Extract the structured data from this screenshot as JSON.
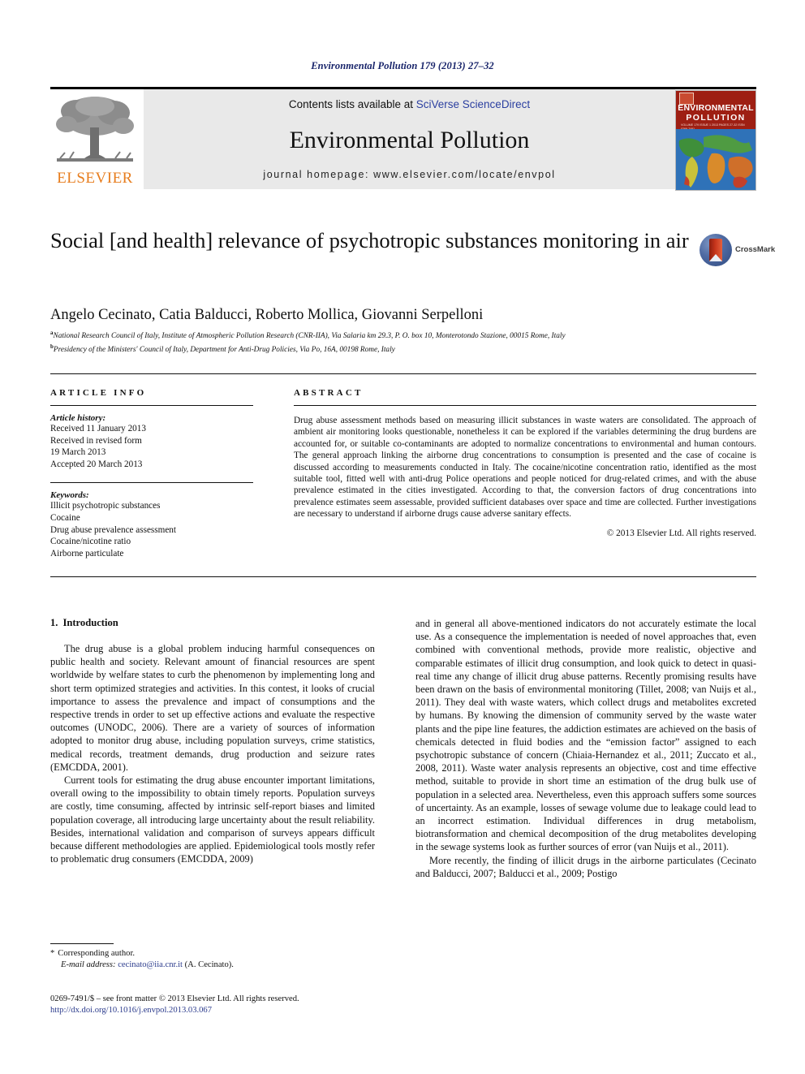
{
  "running_head": "Environmental Pollution 179 (2013) 27–32",
  "masthead": {
    "publisher_logo_label": "ELSEVIER",
    "contents_prefix": "Contents lists available at ",
    "contents_link": "SciVerse ScienceDirect",
    "journal_title": "Environmental Pollution",
    "homepage_line": "journal homepage: www.elsevier.com/locate/envpol",
    "cover": {
      "line1": "ENVIRONMENTAL",
      "line2": "POLLUTION",
      "meta": "VOLUME 179   ISSUE 1   2013   PAGES 27-32   ISSN 0269-7491"
    }
  },
  "article": {
    "title": "Social [and health] relevance of psychotropic substances monitoring in air",
    "crossmark_label": "CrossMark",
    "authors": "Angelo Cecinato, Catia Balducci, Roberto Mollica, Giovanni Serpelloni",
    "affiliation_a": "National Research Council of Italy, Institute of Atmospheric Pollution Research (CNR-IIA), Via Salaria km 29.3, P. O. box 10, Monterotondo Stazione, 00015 Rome, Italy",
    "affiliation_b": "Presidency of the Ministers' Council of Italy, Department for Anti-Drug Policies, Via Po, 16A, 00198 Rome, Italy"
  },
  "article_info": {
    "heading": "ARTICLE INFO",
    "history_label": "Article history:",
    "history": [
      "Received 11 January 2013",
      "Received in revised form",
      "19 March 2013",
      "Accepted 20 March 2013"
    ],
    "keywords_label": "Keywords:",
    "keywords": [
      "Illicit psychotropic substances",
      "Cocaine",
      "Drug abuse prevalence assessment",
      "Cocaine/nicotine ratio",
      "Airborne particulate"
    ]
  },
  "abstract": {
    "heading": "ABSTRACT",
    "text": "Drug abuse assessment methods based on measuring illicit substances in waste waters are consolidated. The approach of ambient air monitoring looks questionable, nonetheless it can be explored if the variables determining the drug burdens are accounted for, or suitable co-contaminants are adopted to normalize concentrations to environmental and human contours. The general approach linking the airborne drug concentrations to consumption is presented and the case of cocaine is discussed according to measurements conducted in Italy. The cocaine/nicotine concentration ratio, identified as the most suitable tool, fitted well with anti-drug Police operations and people noticed for drug-related crimes, and with the abuse prevalence estimated in the cities investigated. According to that, the conversion factors of drug concentrations into prevalence estimates seem assessable, provided sufficient databases over space and time are collected. Further investigations are necessary to understand if airborne drugs cause adverse sanitary effects.",
    "copyright": "© 2013 Elsevier Ltd. All rights reserved."
  },
  "section": {
    "number": "1.",
    "heading": "Introduction"
  },
  "body": {
    "left": [
      "The drug abuse is a global problem inducing harmful consequences on public health and society. Relevant amount of financial resources are spent worldwide by welfare states to curb the phenomenon by implementing long and short term optimized strategies and activities. In this contest, it looks of crucial importance to assess the prevalence and impact of consumptions and the respective trends in order to set up effective actions and evaluate the respective outcomes (UNODC, 2006). There are a variety of sources of information adopted to monitor drug abuse, including population surveys, crime statistics, medical records, treatment demands, drug production and seizure rates (EMCDDA, 2001).",
      "Current tools for estimating the drug abuse encounter important limitations, overall owing to the impossibility to obtain timely reports. Population surveys are costly, time consuming, affected by intrinsic self-report biases and limited population coverage, all introducing large uncertainty about the result reliability. Besides, international validation and comparison of surveys appears difficult because different methodologies are applied. Epidemiological tools mostly refer to problematic drug consumers (EMCDDA, 2009)"
    ],
    "right": [
      "and in general all above-mentioned indicators do not accurately estimate the local use. As a consequence the implementation is needed of novel approaches that, even combined with conventional methods, provide more realistic, objective and comparable estimates of illicit drug consumption, and look quick to detect in quasi-real time any change of illicit drug abuse patterns. Recently promising results have been drawn on the basis of environmental monitoring (Tillet, 2008; van Nuijs et al., 2011). They deal with waste waters, which collect drugs and metabolites excreted by humans. By knowing the dimension of community served by the waste water plants and the pipe line features, the addiction estimates are achieved on the basis of chemicals detected in fluid bodies and the “emission factor” assigned to each psychotropic substance of concern (Chiaia-Hernandez et al., 2011; Zuccato et al., 2008, 2011). Waste water analysis represents an objective, cost and time effective method, suitable to provide in short time an estimation of the drug bulk use of population in a selected area. Nevertheless, even this approach suffers some sources of uncertainty. As an example, losses of sewage volume due to leakage could lead to an incorrect estimation. Individual differences in drug metabolism, biotransformation and chemical decomposition of the drug metabolites developing in the sewage systems look as further sources of error (van Nuijs et al., 2011).",
      "More recently, the finding of illicit drugs in the airborne particulates (Cecinato and Balducci, 2007; Balducci et al., 2009; Postigo"
    ]
  },
  "footnote": {
    "corresponding": "Corresponding author.",
    "email_label": "E-mail address:",
    "email": "cecinato@iia.cnr.it",
    "email_suffix": "(A. Cecinato)."
  },
  "copyright_block": {
    "issn_line": "0269-7491/$ – see front matter © 2013 Elsevier Ltd. All rights reserved.",
    "doi": "http://dx.doi.org/10.1016/j.envpol.2013.03.067"
  },
  "colors": {
    "link": "#2b3b8c",
    "running_head": "#19256b",
    "elsevier_orange": "#e77d1e",
    "banner_grey": "#e9e9e9",
    "cover_red": "#9e1f13"
  }
}
